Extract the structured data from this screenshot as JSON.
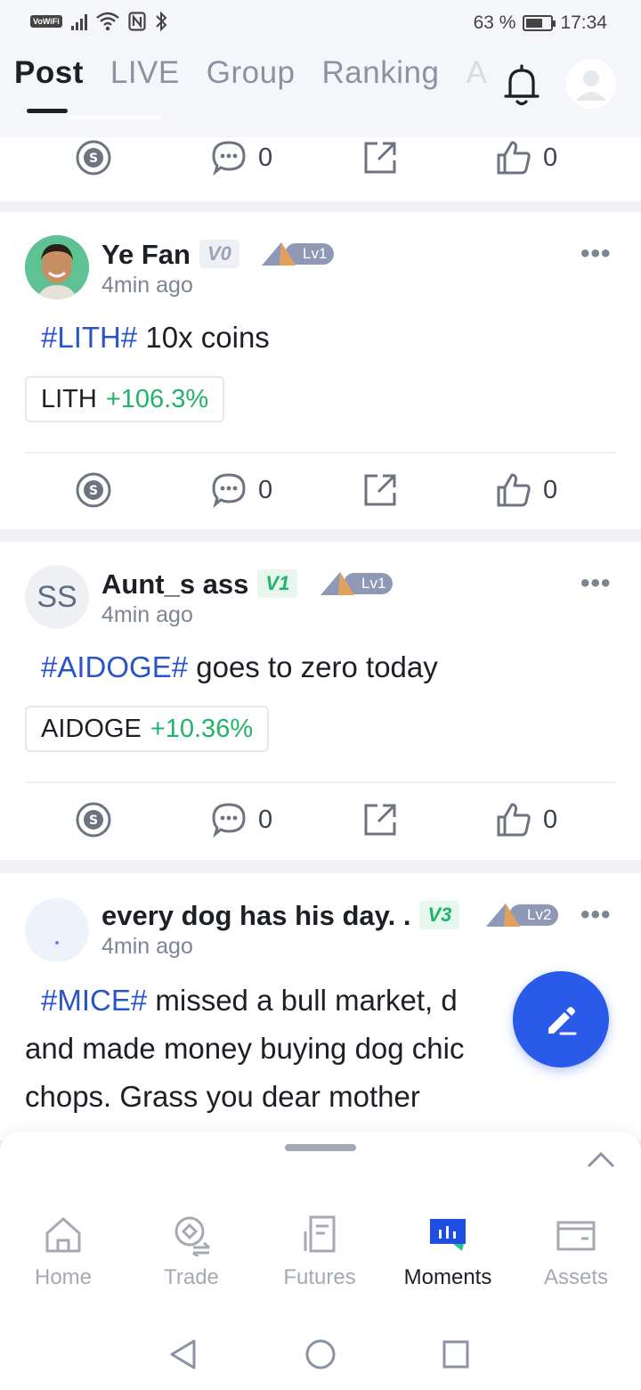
{
  "status_bar": {
    "vowifi": "VoWiFi",
    "battery_percent": "63 %",
    "time": "17:34"
  },
  "top_nav": {
    "tabs": [
      {
        "label": "Post",
        "active": true
      },
      {
        "label": "LIVE",
        "active": false
      },
      {
        "label": "Group",
        "active": false
      },
      {
        "label": "Ranking",
        "active": false
      },
      {
        "label": "A",
        "active": false
      }
    ],
    "icons": {
      "bell": "bell-icon",
      "avatar": "profile-avatar-icon"
    }
  },
  "top_card": {
    "comments": "0",
    "likes": "0"
  },
  "posts": [
    {
      "username": "Ye Fan",
      "vip": "V0",
      "level": "Lv1",
      "time": "4min ago",
      "hashtag": "#LITH#",
      "text": " 10x coins",
      "coin": "LITH",
      "change": "+106.3%",
      "comments": "0",
      "likes": "0"
    },
    {
      "avatar_initials": "SS",
      "username": "Aunt_s ass",
      "vip": "V1",
      "level": "Lv1",
      "time": "4min ago",
      "hashtag": "#AIDOGE#",
      "text": " goes to zero today",
      "coin": "AIDOGE",
      "change": "+10.36%",
      "comments": "0",
      "likes": "0"
    },
    {
      "username": "every dog has his day. .",
      "vip": "V3",
      "level": "Lv2",
      "time": "4min ago",
      "hashtag": "#MICE#",
      "text_line1": " missed a bull market, d",
      "text_line2": "and made money buying dog chic",
      "text_line3": "chops. Grass you dear mother"
    }
  ],
  "bottom_nav": [
    {
      "label": "Home",
      "icon": "home-icon",
      "active": false
    },
    {
      "label": "Trade",
      "icon": "trade-icon",
      "active": false
    },
    {
      "label": "Futures",
      "icon": "futures-icon",
      "active": false
    },
    {
      "label": "Moments",
      "icon": "moments-icon",
      "active": true
    },
    {
      "label": "Assets",
      "icon": "assets-icon",
      "active": false
    }
  ],
  "colors": {
    "accent": "#2a5ae8",
    "hashtag": "#2a55c8",
    "positive": "#22b36a",
    "muted": "#a4a9b3"
  }
}
